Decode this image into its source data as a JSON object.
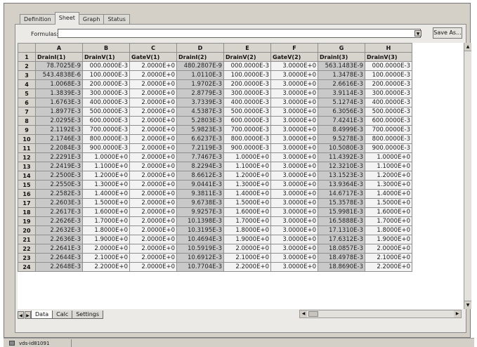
{
  "tabs": [
    "Definition",
    "Sheet",
    "Graph",
    "Status"
  ],
  "active_tab": 1,
  "formulas": {
    "label": "Formulas:",
    "value": "",
    "save_as": "Save As..."
  },
  "columns": [
    "A",
    "B",
    "C",
    "D",
    "E",
    "F",
    "G",
    "H"
  ],
  "column_names": [
    "DrainI(1)",
    "DrainV(1)",
    "GateV(1)",
    "DrainI(2)",
    "DrainV(2)",
    "GateV(2)",
    "DrainI(3)",
    "DrainV(3)"
  ],
  "rows": [
    [
      "78.7025E-9",
      "000.0000E-3",
      "2.0000E+0",
      "480.2807E-9",
      "000.0000E-3",
      "3.0000E+0",
      "563.1483E-9",
      "000.0000E-3"
    ],
    [
      "543.4838E-6",
      "100.0000E-3",
      "2.0000E+0",
      "1.0110E-3",
      "100.0000E-3",
      "3.0000E+0",
      "1.3478E-3",
      "100.0000E-3"
    ],
    [
      "1.0068E-3",
      "200.0000E-3",
      "2.0000E+0",
      "1.9702E-3",
      "200.0000E-3",
      "3.0000E+0",
      "2.6616E-3",
      "200.0000E-3"
    ],
    [
      "1.3839E-3",
      "300.0000E-3",
      "2.0000E+0",
      "2.8779E-3",
      "300.0000E-3",
      "3.0000E+0",
      "3.9114E-3",
      "300.0000E-3"
    ],
    [
      "1.6763E-3",
      "400.0000E-3",
      "2.0000E+0",
      "3.7339E-3",
      "400.0000E-3",
      "3.0000E+0",
      "5.1274E-3",
      "400.0000E-3"
    ],
    [
      "1.8977E-3",
      "500.0000E-3",
      "2.0000E+0",
      "4.5387E-3",
      "500.0000E-3",
      "3.0000E+0",
      "6.3056E-3",
      "500.0000E-3"
    ],
    [
      "2.0295E-3",
      "600.0000E-3",
      "2.0000E+0",
      "5.2803E-3",
      "600.0000E-3",
      "3.0000E+0",
      "7.4241E-3",
      "600.0000E-3"
    ],
    [
      "2.1192E-3",
      "700.0000E-3",
      "2.0000E+0",
      "5.9823E-3",
      "700.0000E-3",
      "3.0000E+0",
      "8.4999E-3",
      "700.0000E-3"
    ],
    [
      "2.1746E-3",
      "800.0000E-3",
      "2.0000E+0",
      "6.6237E-3",
      "800.0000E-3",
      "3.0000E+0",
      "9.5278E-3",
      "800.0000E-3"
    ],
    [
      "2.2084E-3",
      "900.0000E-3",
      "2.0000E+0",
      "7.2119E-3",
      "900.0000E-3",
      "3.0000E+0",
      "10.5080E-3",
      "900.0000E-3"
    ],
    [
      "2.2291E-3",
      "1.0000E+0",
      "2.0000E+0",
      "7.7467E-3",
      "1.0000E+0",
      "3.0000E+0",
      "11.4392E-3",
      "1.0000E+0"
    ],
    [
      "2.2419E-3",
      "1.1000E+0",
      "2.0000E+0",
      "8.2294E-3",
      "1.1000E+0",
      "3.0000E+0",
      "12.3210E-3",
      "1.1000E+0"
    ],
    [
      "2.2500E-3",
      "1.2000E+0",
      "2.0000E+0",
      "8.6612E-3",
      "1.2000E+0",
      "3.0000E+0",
      "13.1523E-3",
      "1.2000E+0"
    ],
    [
      "2.2550E-3",
      "1.3000E+0",
      "2.0000E+0",
      "9.0441E-3",
      "1.3000E+0",
      "3.0000E+0",
      "13.9364E-3",
      "1.3000E+0"
    ],
    [
      "2.2582E-3",
      "1.4000E+0",
      "2.0000E+0",
      "9.3811E-3",
      "1.4000E+0",
      "3.0000E+0",
      "14.6717E-3",
      "1.4000E+0"
    ],
    [
      "2.2603E-3",
      "1.5000E+0",
      "2.0000E+0",
      "9.6738E-3",
      "1.5000E+0",
      "3.0000E+0",
      "15.3578E-3",
      "1.5000E+0"
    ],
    [
      "2.2617E-3",
      "1.6000E+0",
      "2.0000E+0",
      "9.9257E-3",
      "1.6000E+0",
      "3.0000E+0",
      "15.9981E-3",
      "1.6000E+0"
    ],
    [
      "2.2626E-3",
      "1.7000E+0",
      "2.0000E+0",
      "10.1398E-3",
      "1.7000E+0",
      "3.0000E+0",
      "16.5888E-3",
      "1.7000E+0"
    ],
    [
      "2.2632E-3",
      "1.8000E+0",
      "2.0000E+0",
      "10.3195E-3",
      "1.8000E+0",
      "3.0000E+0",
      "17.1310E-3",
      "1.8000E+0"
    ],
    [
      "2.2636E-3",
      "1.9000E+0",
      "2.0000E+0",
      "10.4694E-3",
      "1.9000E+0",
      "3.0000E+0",
      "17.6312E-3",
      "1.9000E+0"
    ],
    [
      "2.2641E-3",
      "2.0000E+0",
      "2.0000E+0",
      "10.5919E-3",
      "2.0000E+0",
      "3.0000E+0",
      "18.0857E-3",
      "2.0000E+0"
    ],
    [
      "2.2644E-3",
      "2.1000E+0",
      "2.0000E+0",
      "10.6912E-3",
      "2.1000E+0",
      "3.0000E+0",
      "18.4978E-3",
      "2.1000E+0"
    ],
    [
      "2.2648E-3",
      "2.2000E+0",
      "2.0000E+0",
      "10.7704E-3",
      "2.2000E+0",
      "3.0000E+0",
      "18.8690E-3",
      "2.2000E+0"
    ]
  ],
  "sheet_tabs": [
    "Data",
    "Calc",
    "Settings"
  ],
  "active_sheet": 0,
  "taskbar": {
    "item": "vds-id81091"
  },
  "colors": {
    "header_bg": "#d7d4ce",
    "selected_cell": "#c9c9c9",
    "cell_bg": "#f3f3f3",
    "frame_bg": "#d4d0c8"
  }
}
